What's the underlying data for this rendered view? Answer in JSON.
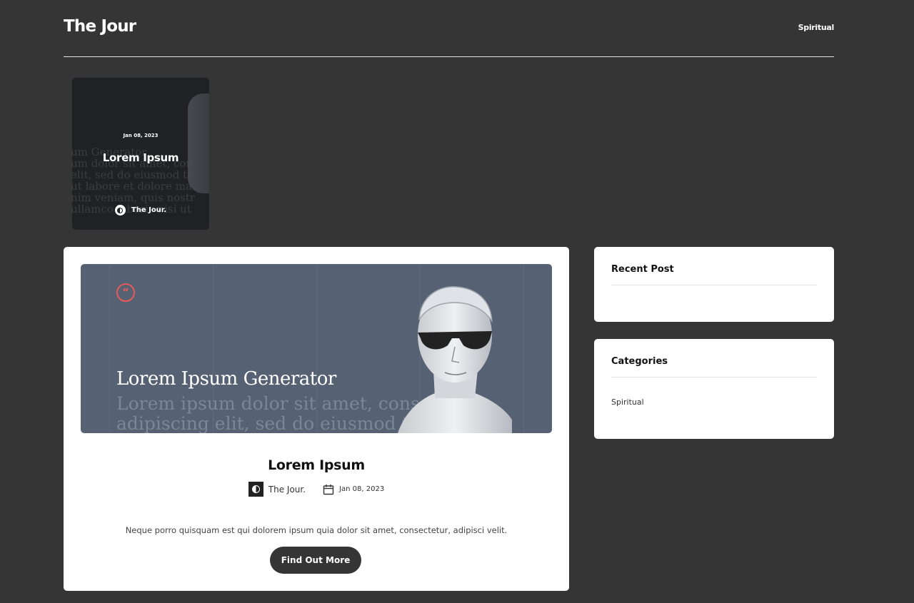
{
  "header": {
    "logo": "The Jour",
    "nav": [
      "Spiritual"
    ]
  },
  "featured": {
    "date": "Jan 08, 2023",
    "title": "Lorem Ipsum",
    "author": "The Jour.",
    "bg_text": [
      "um Generator",
      "um dolor sit amet, con",
      "elit, sed do eiusmod te",
      "ut labore et dolore ma",
      "nim veniam, quis nostr",
      "ullamco laboris nisi ut"
    ]
  },
  "post": {
    "banner_title": "Lorem Ipsum Generator",
    "banner_sub": [
      "Lorem ipsum dolor sit amet, cons",
      "adipiscing elit, sed do eiusmod te"
    ],
    "title": "Lorem Ipsum",
    "author": "The Jour.",
    "date": "Jan 08, 2023",
    "excerpt": "Neque porro quisquam est qui dolorem ipsum quia dolor sit amet, consectetur, adipisci velit.",
    "button": "Find Out More"
  },
  "sidebar": {
    "recent": {
      "title": "Recent Post"
    },
    "categories": {
      "title": "Categories",
      "items": [
        "Spiritual"
      ]
    }
  },
  "colors": {
    "background": "#353535",
    "accent": "#e65a5a",
    "banner": "#566273"
  }
}
